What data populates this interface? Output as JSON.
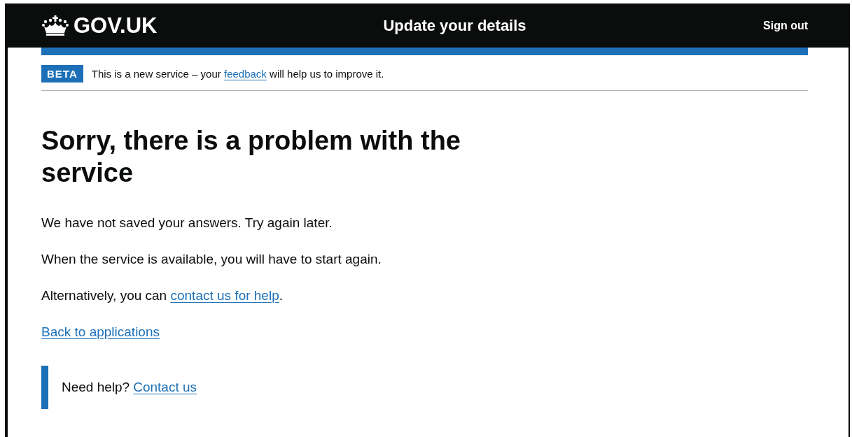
{
  "header": {
    "logo": "GOV.UK",
    "title": "Update your details",
    "sign_out": "Sign out"
  },
  "phase_banner": {
    "tag": "BETA",
    "before": "This is a new service – your ",
    "link": "feedback",
    "after": " will help us to improve it."
  },
  "heading": "Sorry, there is a problem with the service",
  "paragraphs": [
    {
      "before": "We have not saved your answers. Try again later."
    },
    {
      "before": "When the service is available, you will have to start again."
    },
    {
      "before": "Alternatively, you can ",
      "link": "contact us for help",
      "after": "."
    }
  ],
  "back_link": "Back to applications",
  "help": {
    "text": "Need help?",
    "link": "Contact us"
  }
}
